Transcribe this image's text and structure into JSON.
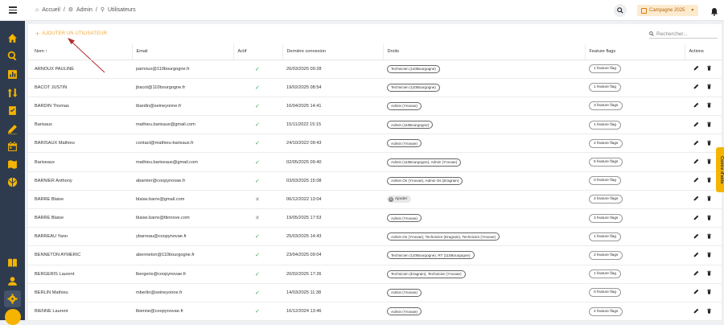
{
  "breadcrumb": {
    "home": "Accueil",
    "admin": "Admin",
    "users": "Utilisateurs"
  },
  "campaign": {
    "label": "Campagne 2025"
  },
  "toolbar": {
    "add_user": "AJOUTER UN UTILISATEUR",
    "search_placeholder": "Rechercher..."
  },
  "columns": {
    "nom": "Nom",
    "email": "Email",
    "actif": "Actif",
    "last": "Dernière connexion",
    "droits": "Droits",
    "flags": "Feature flags",
    "actions": "Actions"
  },
  "help_tab": "Centre d'aide",
  "add_button": "Ajouter",
  "rows": [
    {
      "nom": "ARNOUX PAULINE",
      "email": "parnoux@110bourgogne.fr",
      "actif": true,
      "last": "26/03/2025 09:28",
      "droits": "Technicien (110Bourgogne)",
      "flags": "1 feature flag"
    },
    {
      "nom": "BACOT JUSTIN",
      "email": "jbacot@110bourgogne.fr",
      "actif": true,
      "last": "19/02/2025 08:54",
      "droits": "Technicien (110Bourgogne)",
      "flags": "1 feature flag"
    },
    {
      "nom": "BARDIN Thomas",
      "email": "tbardin@seineyonne.fr",
      "actif": true,
      "last": "16/04/2025 14:41",
      "droits": "Admin (Ynovae)",
      "flags": "3 feature flags"
    },
    {
      "nom": "Barisaux",
      "email": "mathieu.barisaux@gmail.com",
      "actif": true,
      "last": "15/11/2022 15:15",
      "droits": "Admin (110Bourgogne)",
      "flags": "1 feature flag"
    },
    {
      "nom": "BARISAUX Mathieu",
      "email": "contact@mathieu-barisaux.fr",
      "actif": true,
      "last": "24/10/2022 09:43",
      "droits": "Admin (Ynovae)",
      "flags": "2 feature flags"
    },
    {
      "nom": "Bariseaux",
      "email": "mathieu.bariseaux@gmail.com",
      "actif": true,
      "last": "02/05/2025 09:40",
      "droits": "Admin (110Bourgogne), Admin (Ynovae)",
      "flags": "5 feature flags"
    },
    {
      "nom": "BARNIER Anthony",
      "email": "abarnier@coopynovae.fr",
      "actif": true,
      "last": "03/03/2025 15:08",
      "droits": "Admin Os (Ynovae), Admin Os (Eragrain)",
      "flags": "0 feature flag"
    },
    {
      "nom": "BARRE Blaise",
      "email": "blaise.barre@gmail.com",
      "actif": false,
      "last": "06/12/2022 13:04",
      "droits": "",
      "flags": "2 feature flags"
    },
    {
      "nom": "BARRE Blaise",
      "email": "blaise.barre@ttinnove.com",
      "actif": false,
      "last": "19/05/2025 17:53",
      "droits": "Admin (Ynovae)",
      "flags": "3 feature flags"
    },
    {
      "nom": "BARREAU Yann",
      "email": "ybarreau@coopynovae.fr",
      "actif": true,
      "last": "25/03/2025 14:43",
      "droits": "Admin Os (Ynovae), Technicien (Eragrain), Technicien (Ynovae)",
      "flags": "1 feature flag"
    },
    {
      "nom": "BENNETON AYMERIC",
      "email": "abenneton@110bourgogne.fr",
      "actif": true,
      "last": "23/04/2025 09:04",
      "droits": "Technicien (110Bourgogne), RT (110Bourgogne)",
      "flags": "2 feature flags"
    },
    {
      "nom": "BERGERIS Laurent",
      "email": "lbergeris@coopynovae.fr",
      "actif": true,
      "last": "20/02/2025 17:26",
      "droits": "Technicien (Eragrain), Technicien (Ynovae)",
      "flags": "1 feature flag"
    },
    {
      "nom": "BERLIN Mathieu",
      "email": "mberlin@seineyonne.fr",
      "actif": true,
      "last": "14/03/2025 11:38",
      "droits": "Admin (Ynovae)",
      "flags": "0 feature flag"
    },
    {
      "nom": "BIENNE Laurent",
      "email": "lbienne@coopynovae.fr",
      "actif": true,
      "last": "16/12/2024 13:46",
      "droits": "Admin (Ynovae)",
      "flags": "4 feature flags"
    }
  ]
}
